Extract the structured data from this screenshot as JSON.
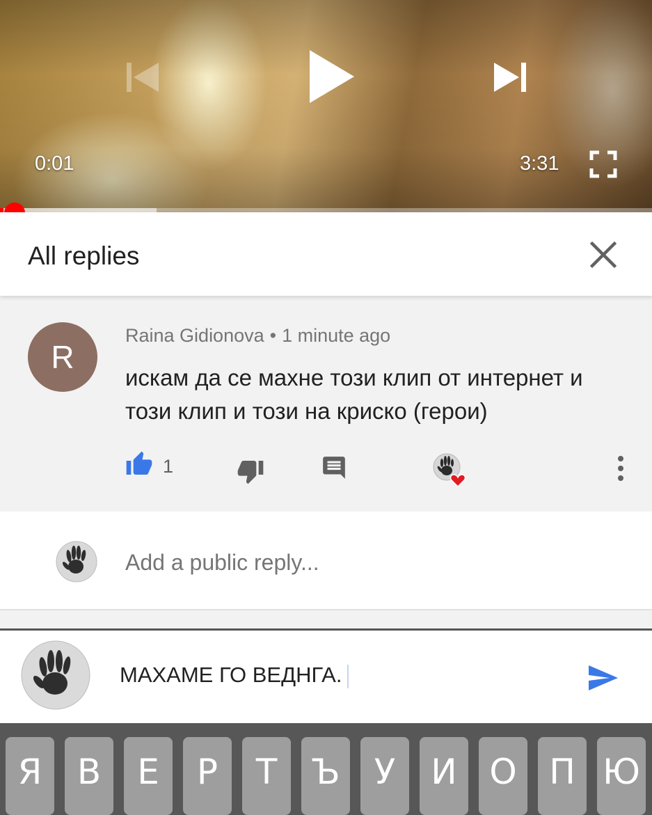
{
  "video": {
    "current_time": "0:01",
    "total_time": "3:31",
    "progress": 0.005,
    "buffered": 0.24,
    "progress_color": "#ff0000"
  },
  "header": {
    "title": "All replies"
  },
  "comment": {
    "avatar_letter": "R",
    "avatar_color": "#8d6e63",
    "author": "Raina Gidionova",
    "separator": "•",
    "time": "1 minute ago",
    "text": "искам да се махне този клип от интернет и този клип и този на криско  (герои)",
    "like_count": "1",
    "like_color": "#3b78e7"
  },
  "add_reply": {
    "placeholder": "Add a public reply..."
  },
  "composer": {
    "value": "МАХАМЕ ГО ВЕДНГА.",
    "send_color": "#3b78e7"
  },
  "keyboard": {
    "keys": [
      "Я",
      "В",
      "Е",
      "Р",
      "Т",
      "Ъ",
      "У",
      "И",
      "О",
      "П",
      "Ю"
    ]
  }
}
